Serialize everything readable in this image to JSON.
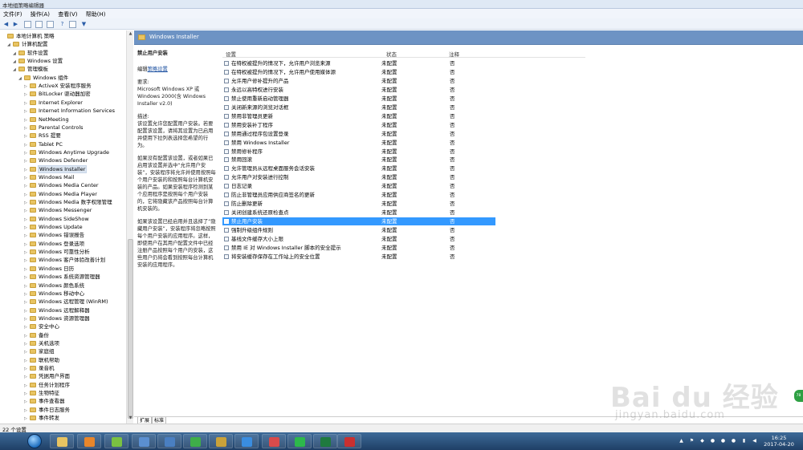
{
  "window": {
    "title": "本地组策略编辑器"
  },
  "menu": [
    "文件(F)",
    "操作(A)",
    "查看(V)",
    "帮助(H)"
  ],
  "tree": {
    "items": [
      {
        "label": "本地计算机 策略",
        "level": 0
      },
      {
        "label": "计算机配置",
        "level": 1
      },
      {
        "label": "软件设置",
        "level": 2
      },
      {
        "label": "Windows 设置",
        "level": 2
      },
      {
        "label": "管理模板",
        "level": 2
      },
      {
        "label": "Windows 组件",
        "level": 3
      },
      {
        "label": "ActiveX 安装程序服务",
        "level": 4
      },
      {
        "label": "BitLocker 驱动器加密",
        "level": 4
      },
      {
        "label": "Internet Explorer",
        "level": 4
      },
      {
        "label": "Internet Information Services",
        "level": 4
      },
      {
        "label": "NetMeeting",
        "level": 4
      },
      {
        "label": "Parental Controls",
        "level": 4
      },
      {
        "label": "RSS 提要",
        "level": 4
      },
      {
        "label": "Tablet PC",
        "level": 4
      },
      {
        "label": "Windows Anytime Upgrade",
        "level": 4
      },
      {
        "label": "Windows Defender",
        "level": 4
      },
      {
        "label": "Windows Installer",
        "level": 4,
        "selected": true
      },
      {
        "label": "Windows Mail",
        "level": 4
      },
      {
        "label": "Windows Media Center",
        "level": 4
      },
      {
        "label": "Windows Media Player",
        "level": 4
      },
      {
        "label": "Windows Media 数字权限管理",
        "level": 4
      },
      {
        "label": "Windows Messenger",
        "level": 4
      },
      {
        "label": "Windows SideShow",
        "level": 4
      },
      {
        "label": "Windows Update",
        "level": 4
      },
      {
        "label": "Windows 错误报告",
        "level": 4
      },
      {
        "label": "Windows 登录选项",
        "level": 4
      },
      {
        "label": "Windows 可靠性分析",
        "level": 4
      },
      {
        "label": "Windows 客户体验改善计划",
        "level": 4
      },
      {
        "label": "Windows 日历",
        "level": 4
      },
      {
        "label": "Windows 系统资源管理器",
        "level": 4
      },
      {
        "label": "Windows 颜色系统",
        "level": 4
      },
      {
        "label": "Windows 移动中心",
        "level": 4
      },
      {
        "label": "Windows 远程管理 (WinRM)",
        "level": 4
      },
      {
        "label": "Windows 远程解释器",
        "level": 4
      },
      {
        "label": "Windows 资源管理器",
        "level": 4
      },
      {
        "label": "安全中心",
        "level": 4
      },
      {
        "label": "备份",
        "level": 4
      },
      {
        "label": "关机选项",
        "level": 4
      },
      {
        "label": "家庭组",
        "level": 4
      },
      {
        "label": "联机帮助",
        "level": 4
      },
      {
        "label": "录音机",
        "level": 4
      },
      {
        "label": "凭据用户界面",
        "level": 4
      },
      {
        "label": "任务计划程序",
        "level": 4
      },
      {
        "label": "生物特征",
        "level": 4
      },
      {
        "label": "事件查看器",
        "level": 4
      },
      {
        "label": "事件日志服务",
        "level": 4
      },
      {
        "label": "事件转发",
        "level": 4
      }
    ]
  },
  "right": {
    "header": "Windows Installer",
    "description": {
      "title": "禁止用户安装",
      "edit_prefix": "编辑",
      "edit_link": "策略设置",
      "requirement_label": "要求:",
      "requirement_text": "Microsoft Windows XP 或 Windows 2000(含 Windows Installer v2.0)",
      "desc_label": "描述:",
      "para1": "该设置允许您配置用户安装。若要配置该设置，请将其设置为已启用并使用下拉列表选择您希望的行为。",
      "para2": "如果没有配置该设置，或者如果已启用该设置并选中“允许用户安装”，安装程序将允许并使用按照每个用户安装的和按照每台计算机安装的产品。如果安装程序检测到某个应用程序是按照每个用户安装的，它将隐藏该产品按照每台计算机安装的。",
      "para3": "如果该设置已经启用并且选择了“隐藏用户安装”，安装程序将忽略按照每个用户安装的应用程序。这样，即使用户在其用户配置文件中已经注册产品按照每个用户的安装，这些用户仍将会看到按照每台计算机安装的应用程序。"
    },
    "columns": {
      "setting": "设置",
      "state": "状态",
      "note": "注释"
    },
    "rows": [
      {
        "name": "在特权被提升的情况下，允许用户浏览来源",
        "state": "未配置",
        "note": "否"
      },
      {
        "name": "在特权被提升的情况下，允许用户使用媒体源",
        "state": "未配置",
        "note": "否"
      },
      {
        "name": "允许用户修补提升的产品",
        "state": "未配置",
        "note": "否"
      },
      {
        "name": "永远以高特权进行安装",
        "state": "未配置",
        "note": "否"
      },
      {
        "name": "禁止使用重新启动管理器",
        "state": "未配置",
        "note": "否"
      },
      {
        "name": "关闭新来源的浏览对话框",
        "state": "未配置",
        "note": "否"
      },
      {
        "name": "禁用非管理员更新",
        "state": "未配置",
        "note": "否"
      },
      {
        "name": "禁用安装补丁程序",
        "state": "未配置",
        "note": "否"
      },
      {
        "name": "禁用通过程序包设置登录",
        "state": "未配置",
        "note": "否"
      },
      {
        "name": "禁用 Windows Installer",
        "state": "未配置",
        "note": "否"
      },
      {
        "name": "禁用修补程序",
        "state": "未配置",
        "note": "否"
      },
      {
        "name": "禁用回滚",
        "state": "未配置",
        "note": "否"
      },
      {
        "name": "允许管理员从远程桌面服务会话安装",
        "state": "未配置",
        "note": "否"
      },
      {
        "name": "允许用户对安装进行控制",
        "state": "未配置",
        "note": "否"
      },
      {
        "name": "日志记录",
        "state": "未配置",
        "note": "否"
      },
      {
        "name": "防止非管理员应用供应商签名的更新",
        "state": "未配置",
        "note": "否"
      },
      {
        "name": "防止删除更新",
        "state": "未配置",
        "note": "否"
      },
      {
        "name": "关闭创建系统还原检查点",
        "state": "未配置",
        "note": "否"
      },
      {
        "name": "禁止用户安装",
        "state": "未配置",
        "note": "否",
        "selected": true
      },
      {
        "name": "强制升级组件规则",
        "state": "未配置",
        "note": "否"
      },
      {
        "name": "基线文件缓存大小上限",
        "state": "未配置",
        "note": "否"
      },
      {
        "name": "禁用 IE 对 Windows Installer 脚本的安全提示",
        "state": "未配置",
        "note": "否"
      },
      {
        "name": "将安装缓存保存在工作站上的安全位置",
        "state": "未配置",
        "note": "否"
      }
    ],
    "tabs": [
      "扩展",
      "标准"
    ]
  },
  "status": {
    "text": "22 个设置"
  },
  "taskbar": {
    "time": "16:25",
    "date": "2017-04-20",
    "apps": [
      {
        "icon": "explorer-icon",
        "color": "#e8c462"
      },
      {
        "icon": "media-player-icon",
        "color": "#e8862b"
      },
      {
        "icon": "green-app-icon",
        "color": "#7ac142"
      },
      {
        "icon": "film-icon",
        "color": "#5b8fd1"
      },
      {
        "icon": "photo-icon",
        "color": "#4a7fc1"
      },
      {
        "icon": "ie-browser-icon",
        "color": "#3fae49"
      },
      {
        "icon": "game-icon",
        "color": "#c9a23a"
      },
      {
        "icon": "cloud-icon",
        "color": "#3a8de0"
      },
      {
        "icon": "record-icon",
        "color": "#d84b4b"
      },
      {
        "icon": "iqiyi-icon",
        "color": "#2db84b"
      },
      {
        "icon": "excel-icon",
        "color": "#1f7a3f"
      },
      {
        "icon": "toolbox-icon",
        "color": "#c93030"
      }
    ]
  },
  "watermark": {
    "brand": "Bai du 经验",
    "url": "jingyan.baidu.com"
  },
  "colors": {
    "selection": "#3399ff",
    "header": "#6d93c4",
    "taskbar": "#2a507d"
  }
}
